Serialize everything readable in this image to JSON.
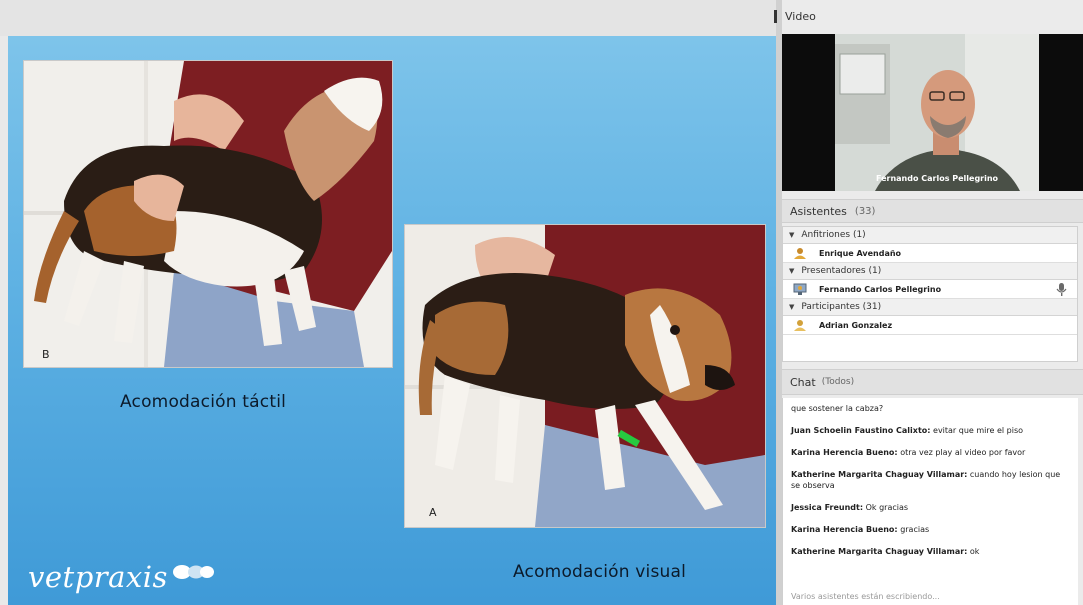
{
  "window": {
    "title": ""
  },
  "slide": {
    "photo1_label": "B",
    "photo2_label": "A",
    "caption_left": "Acomodación táctil",
    "caption_right": "Acomodación visual",
    "logo_text": "vetpraxis"
  },
  "video": {
    "header": "Video",
    "presenter_name": "Fernando Carlos Pellegrino"
  },
  "attendees": {
    "header": "Asistentes",
    "count": "(33)",
    "groups": [
      {
        "label": "Anfitriones (1)",
        "people": [
          "Enrique Avendaño"
        ]
      },
      {
        "label": "Presentadores (1)",
        "people": [
          "Fernando Carlos Pellegrino"
        ]
      },
      {
        "label": "Participantes (31)",
        "people": [
          "Adrian Gonzalez"
        ]
      }
    ]
  },
  "chat": {
    "header": "Chat",
    "scope": "(Todos)",
    "messages": [
      {
        "author": "",
        "text": "que sostener la cabza?"
      },
      {
        "author": "Juan Schoelin Faustino Calixto:",
        "text": "evitar que mire el piso"
      },
      {
        "author": "Karina Herencia Bueno:",
        "text": "otra vez play al video por favor"
      },
      {
        "author": "Katherine Margarita Chaguay Villamar:",
        "text": "cuando hoy lesion que se observa"
      },
      {
        "author": "Jessica Freundt:",
        "text": "Ok gracias"
      },
      {
        "author": "Karina Herencia Bueno:",
        "text": "gracias"
      },
      {
        "author": "Katherine Margarita Chaguay Villamar:",
        "text": "ok"
      }
    ],
    "typing_status": "Varios asistentes están escribiendo..."
  },
  "colors": {
    "slide_top": "#7ec4ea",
    "slide_bottom": "#3f9ad7",
    "panel_bg": "#ebebeb"
  }
}
